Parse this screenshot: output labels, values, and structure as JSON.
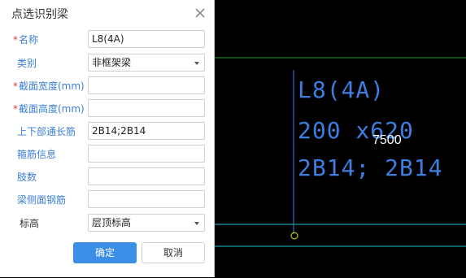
{
  "dialog": {
    "title": "点选识别梁",
    "fields": [
      {
        "label": "名称",
        "required": true,
        "value": "L8(4A)",
        "type": "input"
      },
      {
        "label": "类别",
        "required": false,
        "value": "非框架梁",
        "type": "select"
      },
      {
        "label": "截面宽度(mm)",
        "required": true,
        "value": "",
        "type": "input"
      },
      {
        "label": "截面高度(mm)",
        "required": true,
        "value": "",
        "type": "input"
      },
      {
        "label": "上下部通长筋",
        "required": false,
        "value": "2B14;2B14",
        "type": "input"
      },
      {
        "label": "箍筋信息",
        "required": false,
        "value": "",
        "type": "input"
      },
      {
        "label": "肢数",
        "required": false,
        "value": "",
        "type": "input"
      },
      {
        "label": "梁侧面钢筋",
        "required": false,
        "value": "",
        "type": "input"
      },
      {
        "label": "标高",
        "required": false,
        "value": "层顶标高",
        "type": "select"
      }
    ],
    "ok_label": "确定",
    "cancel_label": "取消"
  },
  "cad": {
    "beam_name": "L8(4A)",
    "beam_section": "200 x620",
    "beam_rebar": "2B14; 2B14",
    "dimension": "7500"
  },
  "colors": {
    "accent": "#3a8ee6",
    "label_blue": "#3c7fd4",
    "required_star": "#e04040",
    "cad_text": "#3d7fe0",
    "cad_green_line": "#2f9e3a",
    "cad_cyan_line": "#19c9c9",
    "cad_marker": "#e6e600"
  }
}
